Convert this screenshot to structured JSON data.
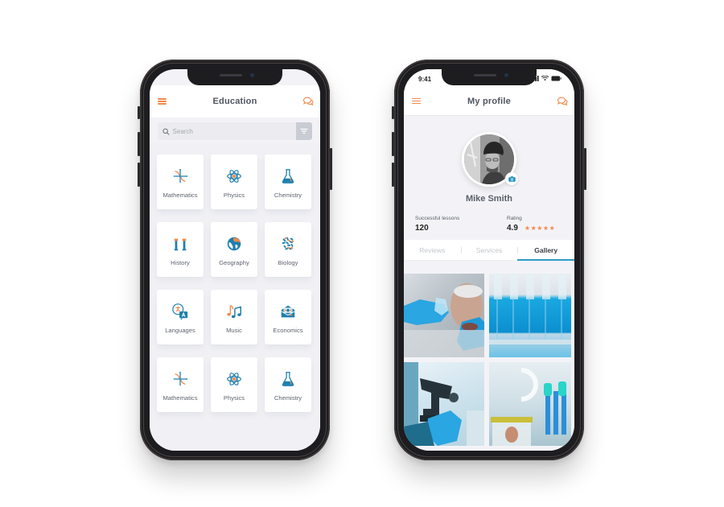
{
  "education_screen": {
    "header": {
      "title": "Education",
      "menu_icon": "hamburger-menu-icon",
      "chat_icon": "chat-bubbles-icon"
    },
    "search": {
      "placeholder": "Search",
      "value": "",
      "filter_icon": "filter-icon"
    },
    "subjects": [
      {
        "label": "Mathematics",
        "icon": "math-graph-icon"
      },
      {
        "label": "Physics",
        "icon": "atom-icon"
      },
      {
        "label": "Chemistry",
        "icon": "flask-icon"
      },
      {
        "label": "History",
        "icon": "columns-icon"
      },
      {
        "label": "Geography",
        "icon": "globe-icon"
      },
      {
        "label": "Biology",
        "icon": "bacteria-icon"
      },
      {
        "label": "Languages",
        "icon": "translate-icon"
      },
      {
        "label": "Music",
        "icon": "music-notes-icon"
      },
      {
        "label": "Economics",
        "icon": "money-envelope-icon"
      },
      {
        "label": "Mathematics",
        "icon": "math-graph-icon"
      },
      {
        "label": "Physics",
        "icon": "atom-icon"
      },
      {
        "label": "Chemistry",
        "icon": "flask-icon"
      }
    ]
  },
  "profile_screen": {
    "status_bar": {
      "time": "9:41"
    },
    "header": {
      "title": "My profile",
      "menu_icon": "hamburger-menu-icon",
      "chat_icon": "chat-bubbles-icon"
    },
    "user": {
      "name": "Mike Smith",
      "avatar_icon": "camera-icon"
    },
    "stats": {
      "lessons_label": "Successful lessons",
      "lessons_value": "120",
      "rating_label": "Rating",
      "rating_value": "4.9",
      "stars": "★★★★★"
    },
    "tabs": [
      {
        "label": "Reviews",
        "active": false
      },
      {
        "label": "Services",
        "active": false
      },
      {
        "label": "Gallery",
        "active": true
      }
    ],
    "gallery": [
      {
        "alt": "Scientist holding blue beakers"
      },
      {
        "alt": "Rack of blue test tubes"
      },
      {
        "alt": "Microscope with gloved hand"
      },
      {
        "alt": "Lab glassware and jar"
      }
    ]
  },
  "colors": {
    "accent_orange": "#f08a4b",
    "accent_blue": "#2f9ac4",
    "icon_blue": "#1f7fae"
  }
}
